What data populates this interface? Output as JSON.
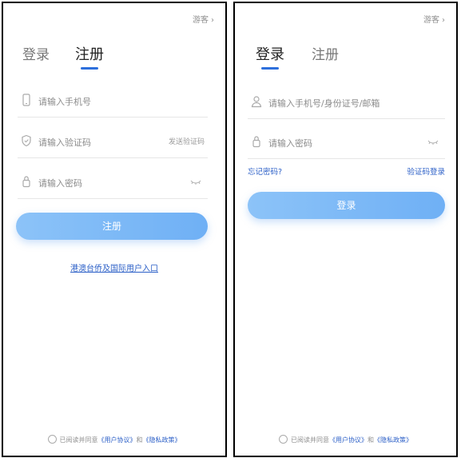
{
  "register_screen": {
    "guest": "游客",
    "tabs": {
      "login": "登录",
      "register": "注册",
      "active": "register"
    },
    "phone": {
      "placeholder": "请输入手机号",
      "icon": "phone-icon"
    },
    "code": {
      "placeholder": "请输入验证码",
      "action": "发送验证码",
      "icon": "shield-icon"
    },
    "password": {
      "placeholder": "请输入密码",
      "icon": "lock-icon"
    },
    "submit": "注册",
    "intl_link": "港澳台侨及国际用户入口",
    "agreement": {
      "prefix": "已阅读并同意",
      "user_terms": "《用户协议》",
      "and": "和",
      "privacy": "《隐私政策》"
    }
  },
  "login_screen": {
    "guest": "游客",
    "tabs": {
      "login": "登录",
      "register": "注册",
      "active": "login"
    },
    "account": {
      "placeholder": "请输入手机号/身份证号/邮箱",
      "icon": "user-icon"
    },
    "password": {
      "placeholder": "请输入密码",
      "icon": "lock-icon"
    },
    "forgot": "忘记密码?",
    "code_login": "验证码登录",
    "submit": "登录",
    "agreement": {
      "prefix": "已阅读并同意",
      "user_terms": "《用户协议》",
      "and": "和",
      "privacy": "《隐私政策》"
    }
  },
  "colors": {
    "accent": "#2d6fdc",
    "button": "#7fbaf6",
    "link": "#2b5fc7"
  }
}
